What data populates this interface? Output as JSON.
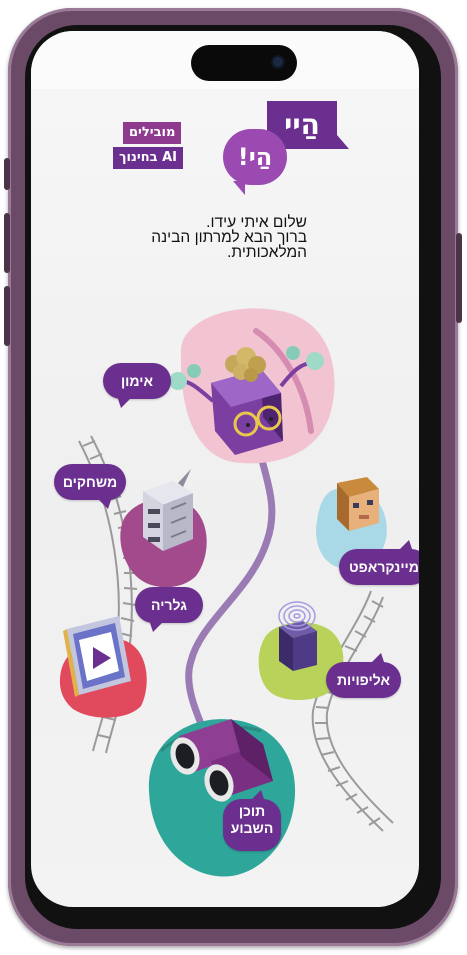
{
  "brand": {
    "tag_top": "מובילים",
    "tag_bottom": "AI בחינוך",
    "logo_primary": "הַיי",
    "logo_secondary": "הַי!"
  },
  "greeting": {
    "line1": "שלום איתי עידו.",
    "line2": "ברוך הבא למרתון הבינה",
    "line3": "המלאכותית."
  },
  "menu": {
    "training": "אימון",
    "games": "משחקים",
    "minecraft": "מיינקראפט",
    "gallery": "גלריה",
    "championships": "אליפויות",
    "weekly_content_line1": "תוכן",
    "weekly_content_line2": "השבוע"
  },
  "colors": {
    "brand_purple": "#6a2f8f",
    "frame": "#6a4a66",
    "path": "#9b7bb4"
  }
}
